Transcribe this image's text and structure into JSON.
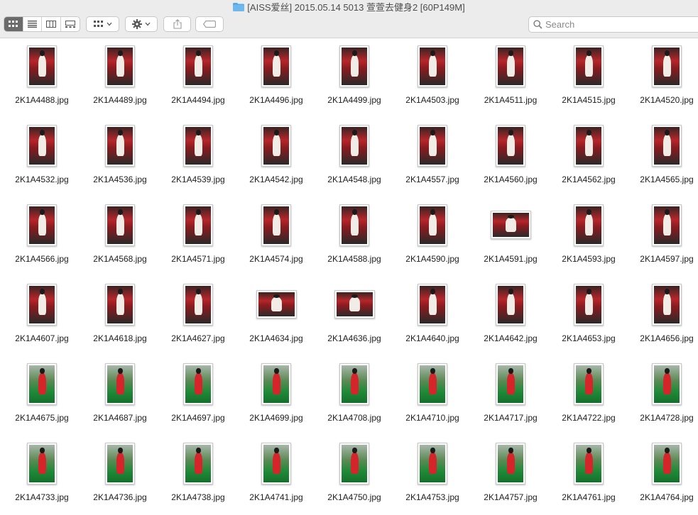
{
  "window": {
    "title": "[AISS爱丝] 2015.05.14 5013 萱萱去健身2 [60P149M]"
  },
  "toolbar": {
    "view_modes": [
      "icon-view",
      "list-view",
      "column-view",
      "gallery-view"
    ],
    "active_view": "icon-view",
    "group_button_icon": "grid-icon",
    "action_button_icon": "gear-icon",
    "share_button_icon": "share-icon",
    "tag_button_icon": "tag-icon"
  },
  "search": {
    "placeholder": "Search"
  },
  "colors": {
    "titlebar": "#ececec",
    "active_segment": "#6b6b6b",
    "folder_icon": "#5aa9e6"
  },
  "files": [
    {
      "name": "2K1A4488.jpg",
      "orientation": "portrait",
      "scene": "red"
    },
    {
      "name": "2K1A4489.jpg",
      "orientation": "portrait",
      "scene": "red"
    },
    {
      "name": "2K1A4494.jpg",
      "orientation": "portrait",
      "scene": "red"
    },
    {
      "name": "2K1A4496.jpg",
      "orientation": "portrait",
      "scene": "red"
    },
    {
      "name": "2K1A4499.jpg",
      "orientation": "portrait",
      "scene": "red"
    },
    {
      "name": "2K1A4503.jpg",
      "orientation": "portrait",
      "scene": "red"
    },
    {
      "name": "2K1A4511.jpg",
      "orientation": "portrait",
      "scene": "red"
    },
    {
      "name": "2K1A4515.jpg",
      "orientation": "portrait",
      "scene": "red"
    },
    {
      "name": "2K1A4520.jpg",
      "orientation": "portrait",
      "scene": "red"
    },
    {
      "name": "2K1A4532.jpg",
      "orientation": "portrait",
      "scene": "red"
    },
    {
      "name": "2K1A4536.jpg",
      "orientation": "portrait",
      "scene": "red"
    },
    {
      "name": "2K1A4539.jpg",
      "orientation": "portrait",
      "scene": "red"
    },
    {
      "name": "2K1A4542.jpg",
      "orientation": "portrait",
      "scene": "red"
    },
    {
      "name": "2K1A4548.jpg",
      "orientation": "portrait",
      "scene": "red"
    },
    {
      "name": "2K1A4557.jpg",
      "orientation": "portrait",
      "scene": "red"
    },
    {
      "name": "2K1A4560.jpg",
      "orientation": "portrait",
      "scene": "red"
    },
    {
      "name": "2K1A4562.jpg",
      "orientation": "portrait",
      "scene": "red"
    },
    {
      "name": "2K1A4565.jpg",
      "orientation": "portrait",
      "scene": "red"
    },
    {
      "name": "2K1A4566.jpg",
      "orientation": "portrait",
      "scene": "red"
    },
    {
      "name": "2K1A4568.jpg",
      "orientation": "portrait",
      "scene": "red"
    },
    {
      "name": "2K1A4571.jpg",
      "orientation": "portrait",
      "scene": "red"
    },
    {
      "name": "2K1A4574.jpg",
      "orientation": "portrait",
      "scene": "red"
    },
    {
      "name": "2K1A4588.jpg",
      "orientation": "portrait",
      "scene": "red"
    },
    {
      "name": "2K1A4590.jpg",
      "orientation": "portrait",
      "scene": "red"
    },
    {
      "name": "2K1A4591.jpg",
      "orientation": "landscape",
      "scene": "red"
    },
    {
      "name": "2K1A4593.jpg",
      "orientation": "portrait",
      "scene": "red"
    },
    {
      "name": "2K1A4597.jpg",
      "orientation": "portrait",
      "scene": "red"
    },
    {
      "name": "2K1A4607.jpg",
      "orientation": "portrait",
      "scene": "red"
    },
    {
      "name": "2K1A4618.jpg",
      "orientation": "portrait",
      "scene": "red"
    },
    {
      "name": "2K1A4627.jpg",
      "orientation": "portrait",
      "scene": "red"
    },
    {
      "name": "2K1A4634.jpg",
      "orientation": "landscape",
      "scene": "red"
    },
    {
      "name": "2K1A4636.jpg",
      "orientation": "landscape",
      "scene": "red"
    },
    {
      "name": "2K1A4640.jpg",
      "orientation": "portrait",
      "scene": "red"
    },
    {
      "name": "2K1A4642.jpg",
      "orientation": "portrait",
      "scene": "red"
    },
    {
      "name": "2K1A4653.jpg",
      "orientation": "portrait",
      "scene": "red"
    },
    {
      "name": "2K1A4656.jpg",
      "orientation": "portrait",
      "scene": "red"
    },
    {
      "name": "2K1A4675.jpg",
      "orientation": "portrait",
      "scene": "green"
    },
    {
      "name": "2K1A4687.jpg",
      "orientation": "portrait",
      "scene": "green"
    },
    {
      "name": "2K1A4697.jpg",
      "orientation": "portrait",
      "scene": "green"
    },
    {
      "name": "2K1A4699.jpg",
      "orientation": "portrait",
      "scene": "green"
    },
    {
      "name": "2K1A4708.jpg",
      "orientation": "portrait",
      "scene": "green"
    },
    {
      "name": "2K1A4710.jpg",
      "orientation": "portrait",
      "scene": "green"
    },
    {
      "name": "2K1A4717.jpg",
      "orientation": "portrait",
      "scene": "green"
    },
    {
      "name": "2K1A4722.jpg",
      "orientation": "portrait",
      "scene": "green"
    },
    {
      "name": "2K1A4728.jpg",
      "orientation": "portrait",
      "scene": "green"
    },
    {
      "name": "2K1A4733.jpg",
      "orientation": "portrait",
      "scene": "green"
    },
    {
      "name": "2K1A4736.jpg",
      "orientation": "portrait",
      "scene": "green"
    },
    {
      "name": "2K1A4738.jpg",
      "orientation": "portrait",
      "scene": "green"
    },
    {
      "name": "2K1A4741.jpg",
      "orientation": "portrait",
      "scene": "green"
    },
    {
      "name": "2K1A4750.jpg",
      "orientation": "portrait",
      "scene": "green"
    },
    {
      "name": "2K1A4753.jpg",
      "orientation": "portrait",
      "scene": "green"
    },
    {
      "name": "2K1A4757.jpg",
      "orientation": "portrait",
      "scene": "green"
    },
    {
      "name": "2K1A4761.jpg",
      "orientation": "portrait",
      "scene": "green"
    },
    {
      "name": "2K1A4764.jpg",
      "orientation": "portrait",
      "scene": "green"
    }
  ]
}
